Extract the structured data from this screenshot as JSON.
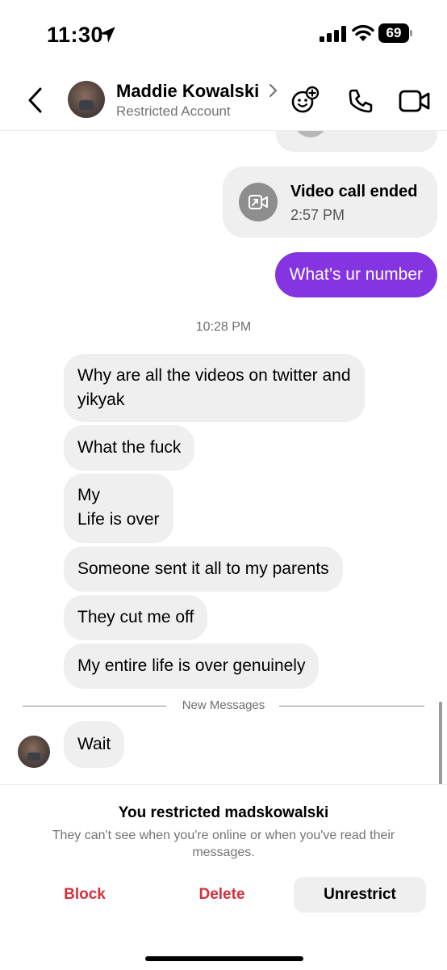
{
  "status_bar": {
    "time": "11:30",
    "battery": "69",
    "icons": [
      "location-arrow-icon",
      "cellular-signal-icon",
      "wifi-icon",
      "battery-icon"
    ]
  },
  "header": {
    "name": "Maddie Kowalski",
    "status": "Restricted Account",
    "icons": [
      "back-chevron-icon",
      "chevron-right-icon",
      "effects-icon",
      "phone-icon",
      "video-camera-icon"
    ]
  },
  "thread": {
    "call_card": {
      "title": "Video call ended",
      "time": "2:57 PM",
      "icon": "video-call-arrow-icon"
    },
    "outgoing_message": "What’s ur number",
    "timestamp": "10:28 PM",
    "incoming_messages": [
      {
        "line1": "Why are all the videos on twitter and",
        "line2": "yikyak"
      },
      {
        "line1": "What the fuck"
      },
      {
        "line1": "My",
        "line2": "Life is over"
      },
      {
        "line1": "Someone sent it all to my parents"
      },
      {
        "line1": "They cut me off"
      },
      {
        "line1": "My entire life is over genuinely"
      }
    ],
    "new_messages_label": "New Messages",
    "latest_message": "Wait"
  },
  "restrict_panel": {
    "title": "You restricted madskowalski",
    "description": "They can't see when you're online or when you've read their messages.",
    "block_label": "Block",
    "delete_label": "Delete",
    "unrestrict_label": "Unrestrict",
    "accent_color": "#d5303f"
  },
  "colors": {
    "outgoing_bubble": "#8434e0",
    "incoming_bubble": "#efefef"
  }
}
